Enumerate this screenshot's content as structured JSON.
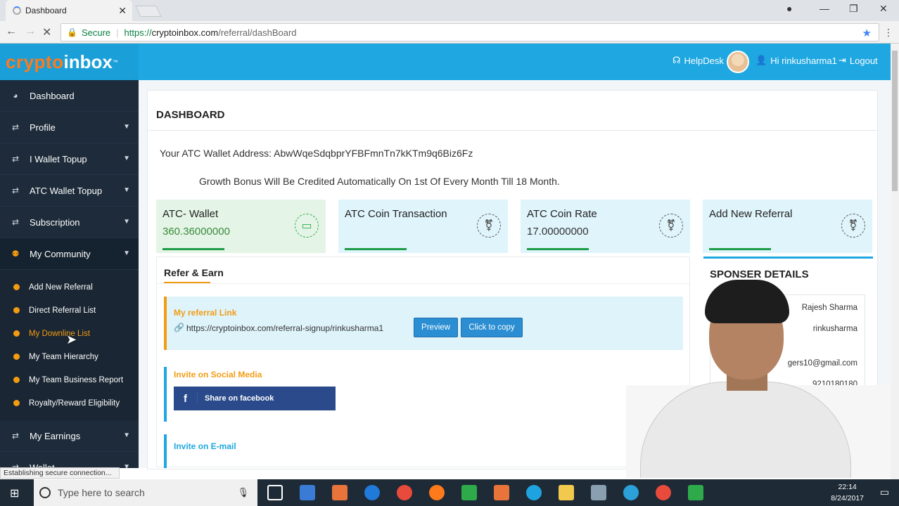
{
  "browser": {
    "tab_title": "Dashboard",
    "secure_label": "Secure",
    "url_proto": "https://",
    "url_host": "cryptoinbox.com",
    "url_path": "/referral/dashBoard",
    "status_text": "Establishing secure connection..."
  },
  "header": {
    "logo_part1": "crypto",
    "logo_part2": "inbox",
    "logo_tm": "™",
    "helpdesk": "HelpDesk",
    "greeting": "Hi rinkusharma1",
    "logout": "Logout"
  },
  "sidebar": {
    "items": [
      {
        "label": "Dashboard"
      },
      {
        "label": "Profile"
      },
      {
        "label": "I Wallet Topup"
      },
      {
        "label": "ATC Wallet Topup"
      },
      {
        "label": "Subscription"
      },
      {
        "label": "My Community"
      }
    ],
    "sub_items": [
      {
        "label": "Add New Referral"
      },
      {
        "label": "Direct Referral List"
      },
      {
        "label": "My Downline List"
      },
      {
        "label": "My Team Hierarchy"
      },
      {
        "label": "My Team Business Report"
      },
      {
        "label": "Royalty/Reward Eligibility"
      }
    ],
    "after_items": [
      {
        "label": "My Earnings"
      },
      {
        "label": "Wallet"
      }
    ]
  },
  "main": {
    "page_title": "DASHBOARD",
    "wallet_label": "Your ATC Wallet Address:",
    "wallet_address": "AbwWqeSdqbprYFBFmnTn7kKTm9q6Biz6Fz",
    "bonus_text": "Growth Bonus Will Be Credited Automatically On 1st Of Every Month Till 18 Month.",
    "cards": [
      {
        "title": "ATC- Wallet",
        "value": "360.36000000"
      },
      {
        "title": "ATC Coin Transaction",
        "value": ""
      },
      {
        "title": "ATC Coin Rate",
        "value": "17.00000000"
      },
      {
        "title": "Add New Referral",
        "value": ""
      }
    ],
    "refer": {
      "title": "Refer & Earn",
      "link_head": "My referral Link",
      "link_url": "https://cryptoinbox.com/referral-signup/rinkusharma1",
      "preview_btn": "Preview",
      "copy_btn": "Click to copy",
      "social_head": "Invite on Social Media",
      "fb_btn": "Share on facebook",
      "email_head": "Invite on E-mail"
    },
    "sponsor": {
      "title": "SPONSER DETAILS",
      "name": "Rajesh Sharma",
      "username": "rinkusharma",
      "email": "gers10@gmail.com",
      "phone": "9210180180"
    }
  },
  "taskbar": {
    "search_placeholder": "Type here to search",
    "time": "22:14",
    "date": "8/24/2017"
  },
  "colors": {
    "header_blue": "#1ea7e1",
    "sidebar_dark": "#1d2b3a",
    "accent_orange": "#f39c12",
    "button_blue": "#2b8ed3"
  }
}
